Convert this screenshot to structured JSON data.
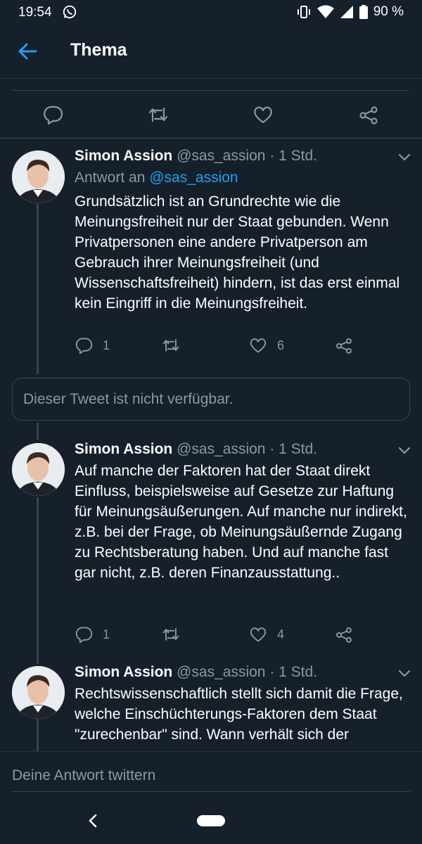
{
  "statusbar": {
    "time": "19:54",
    "battery": "90 %"
  },
  "appbar": {
    "title": "Thema"
  },
  "tweets": [
    {
      "name": "Simon Assion",
      "handle": "@sas_assion",
      "sep": " · ",
      "time": "1 Std.",
      "reply_prefix": "Antwort an ",
      "reply_to": "@sas_assion",
      "text": "Grundsätzlich ist an Grundrechte wie die Meinungsfreiheit nur der Staat gebunden. Wenn Privatpersonen eine andere Privatperson am Gebrauch ihrer Meinungsfreiheit (und Wissenschaftsfreiheit) hindern, ist das erst einmal kein Eingriff in die Meinungsfreiheit.",
      "replies": "1",
      "likes": "6"
    },
    {
      "name": "Simon Assion",
      "handle": "@sas_assion",
      "sep": " · ",
      "time": "1 Std.",
      "text": "Auf manche der Faktoren hat der Staat direkt Einfluss, beispielsweise auf Gesetze zur Haftung für Meinungsäußerungen. Auf manche nur indirekt, z.B. bei der Frage, ob Meinungsäußernde Zugang zu Rechtsberatung haben. Und auf manche fast gar nicht, z.B. deren Finanzausstattung..",
      "replies": "1",
      "likes": "4"
    },
    {
      "name": "Simon Assion",
      "handle": "@sas_assion",
      "sep": " · ",
      "time": "1 Std.",
      "text": "Rechtswissenschaftlich stellt sich damit die Frage, welche Einschüchterungs-Faktoren dem Staat \"zurechenbar\" sind. Wann verhält sich der"
    }
  ],
  "unavailable": {
    "text": "Dieser Tweet ist nicht verfügbar."
  },
  "composer": {
    "placeholder": "Deine Antwort twittern"
  },
  "colors": {
    "background": "#15202b",
    "accent": "#1da1f2",
    "muted": "#8899a6",
    "border": "#38444d"
  }
}
